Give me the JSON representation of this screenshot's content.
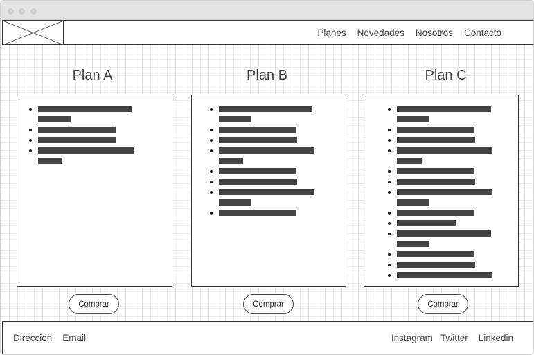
{
  "window": {
    "dots_color": "#cfcfcf"
  },
  "nav": {
    "logo": "image-placeholder-icon",
    "links": [
      "Planes",
      "Novedades",
      "Nosotros",
      "Contacto"
    ]
  },
  "plans": [
    {
      "title": "Plan A",
      "button": "Comprar",
      "items": 4
    },
    {
      "title": "Plan B",
      "button": "Comprar",
      "items": 8
    },
    {
      "title": "Plan C",
      "button": "Comprar",
      "items": 13
    }
  ],
  "footer": {
    "left": [
      "Direccion",
      "Email"
    ],
    "right": [
      "Instagram",
      "Twitter",
      "Linkedin"
    ]
  },
  "colors": {
    "text_placeholder_bar": "#444444",
    "border": "#333333",
    "grid": "#ececec"
  }
}
